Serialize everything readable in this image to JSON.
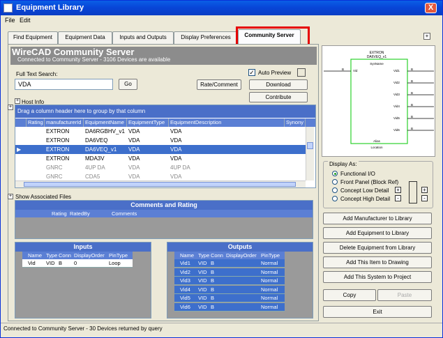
{
  "window": {
    "title": "Equipment Library",
    "close": "X"
  },
  "menu": [
    "File",
    "Edit"
  ],
  "tabs": [
    "Find Equipment",
    "Equipment Data",
    "Inputs and Outputs",
    "Display Preferences",
    "Community Server"
  ],
  "header": {
    "title": "WireCAD Community Server",
    "subtitle": "Connected to Community Server - 3106 Devices are available"
  },
  "search": {
    "label": "Full Text Search:",
    "value": "VDA",
    "go": "Go",
    "rate_comment": "Rate/Comment",
    "auto_preview": "Auto Preview",
    "download": "Download",
    "contribute": "Contribute"
  },
  "host_info": "Host Info",
  "group_hint": "Drag a column header here to group by that column",
  "columns": [
    "Rating",
    "manufacturerId",
    "EquipmentName",
    "EquipmentType",
    "EquipmentDescription",
    "Synony"
  ],
  "rows": [
    {
      "mfr": "EXTRON",
      "name": "DA6RGBHV_v1",
      "type": "VDA",
      "desc": "VDA",
      "style": "normal"
    },
    {
      "mfr": "EXTRON",
      "name": "DA6VEQ",
      "type": "VDA",
      "desc": "VDA",
      "style": "normal"
    },
    {
      "mfr": "EXTRON",
      "name": "DA6VEQ_v1",
      "type": "VDA",
      "desc": "VDA",
      "style": "selected"
    },
    {
      "mfr": "EXTRON",
      "name": "MDA3V",
      "type": "VDA",
      "desc": "VDA",
      "style": "normal"
    },
    {
      "mfr": "GNRC",
      "name": "4UP DA",
      "type": "VDA",
      "desc": "4UP DA",
      "style": "gray"
    },
    {
      "mfr": "GNRC",
      "name": "CDA5",
      "type": "VDA",
      "desc": "VDA",
      "style": "gray"
    }
  ],
  "assoc_files": "Show Associated Files",
  "comments": {
    "title": "Comments and Rating",
    "columns": [
      "Rating",
      "RatedBy",
      "Comments"
    ]
  },
  "inputs": {
    "title": "Inputs",
    "columns": [
      "Name",
      "Type",
      "Conn",
      "DisplayOrder",
      "PinType"
    ],
    "rows": [
      [
        "Vid",
        "VID",
        "B",
        "0",
        "Loop"
      ]
    ]
  },
  "outputs": {
    "title": "Outputs",
    "columns": [
      "Name",
      "Type",
      "Conn",
      "DisplayOrder",
      "PinType"
    ],
    "rows": [
      [
        "Vid1",
        "VID",
        "B",
        "",
        "Normal"
      ],
      [
        "Vid2",
        "VID",
        "B",
        "",
        "Normal"
      ],
      [
        "Vid3",
        "VID",
        "B",
        "",
        "Normal"
      ],
      [
        "Vid4",
        "VID",
        "B",
        "",
        "Normal"
      ],
      [
        "Vid5",
        "VID",
        "B",
        "",
        "Normal"
      ],
      [
        "Vid6",
        "VID",
        "B",
        "",
        "Normal"
      ]
    ]
  },
  "preview": {
    "mfr": "EXTRON",
    "model": "DA6VEQ_v1",
    "sysname": "SysName",
    "alias": "Alias",
    "location": "Location",
    "input": "Vid",
    "outputs": [
      "Vid1",
      "Vid2",
      "Vid3",
      "Vid4",
      "Vid5",
      "Vid6"
    ],
    "conn": "B"
  },
  "display_as": {
    "title": "Display As:",
    "options": [
      "Functional I/O",
      "Front Panel (Block Ref)",
      "Concept Low Detail",
      "Concept High Detail"
    ],
    "selected": 0
  },
  "actions": [
    "Add Manufacturer to Library",
    "Add Equipment to Library",
    "Delete Equipment from Library",
    "Add This Item to Drawing",
    "Add This System to Project"
  ],
  "copy": "Copy",
  "paste": "Paste",
  "exit": "Exit",
  "status": "Connected to Community Server - 30 Devices returned by query"
}
